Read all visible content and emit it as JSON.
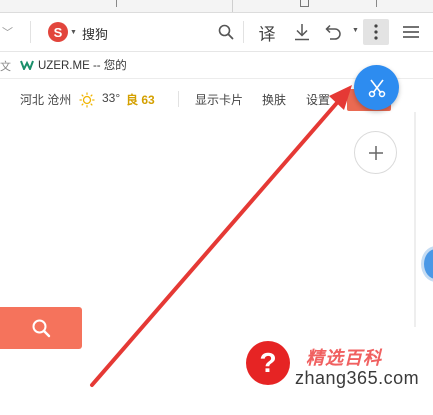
{
  "toolbar": {
    "search_engine_logo": "S",
    "search_text": "搜狗",
    "translate_label": "译",
    "colors": {
      "engine_red": "#e2453c"
    }
  },
  "bookmarks": {
    "left_fragment": "⽂",
    "item_icon": "w-logo-icon",
    "item_label": "UZER.ME -- 您的"
  },
  "infobar": {
    "location": "河北 沧州",
    "temperature": "33°",
    "air_quality": "良 63",
    "show_card": "显示卡片",
    "change_skin": "换肤",
    "settings": "设置"
  },
  "floating": {
    "blue_button_icon": "scissors-icon",
    "add_button_icon": "plus-icon",
    "accent": "#2d8cf0"
  },
  "search": {
    "button_icon": "search-icon",
    "button_color": "#f5735c"
  },
  "watermark": {
    "badge": "?",
    "brand_cn": "精选百科",
    "url": "zhang365.com"
  }
}
